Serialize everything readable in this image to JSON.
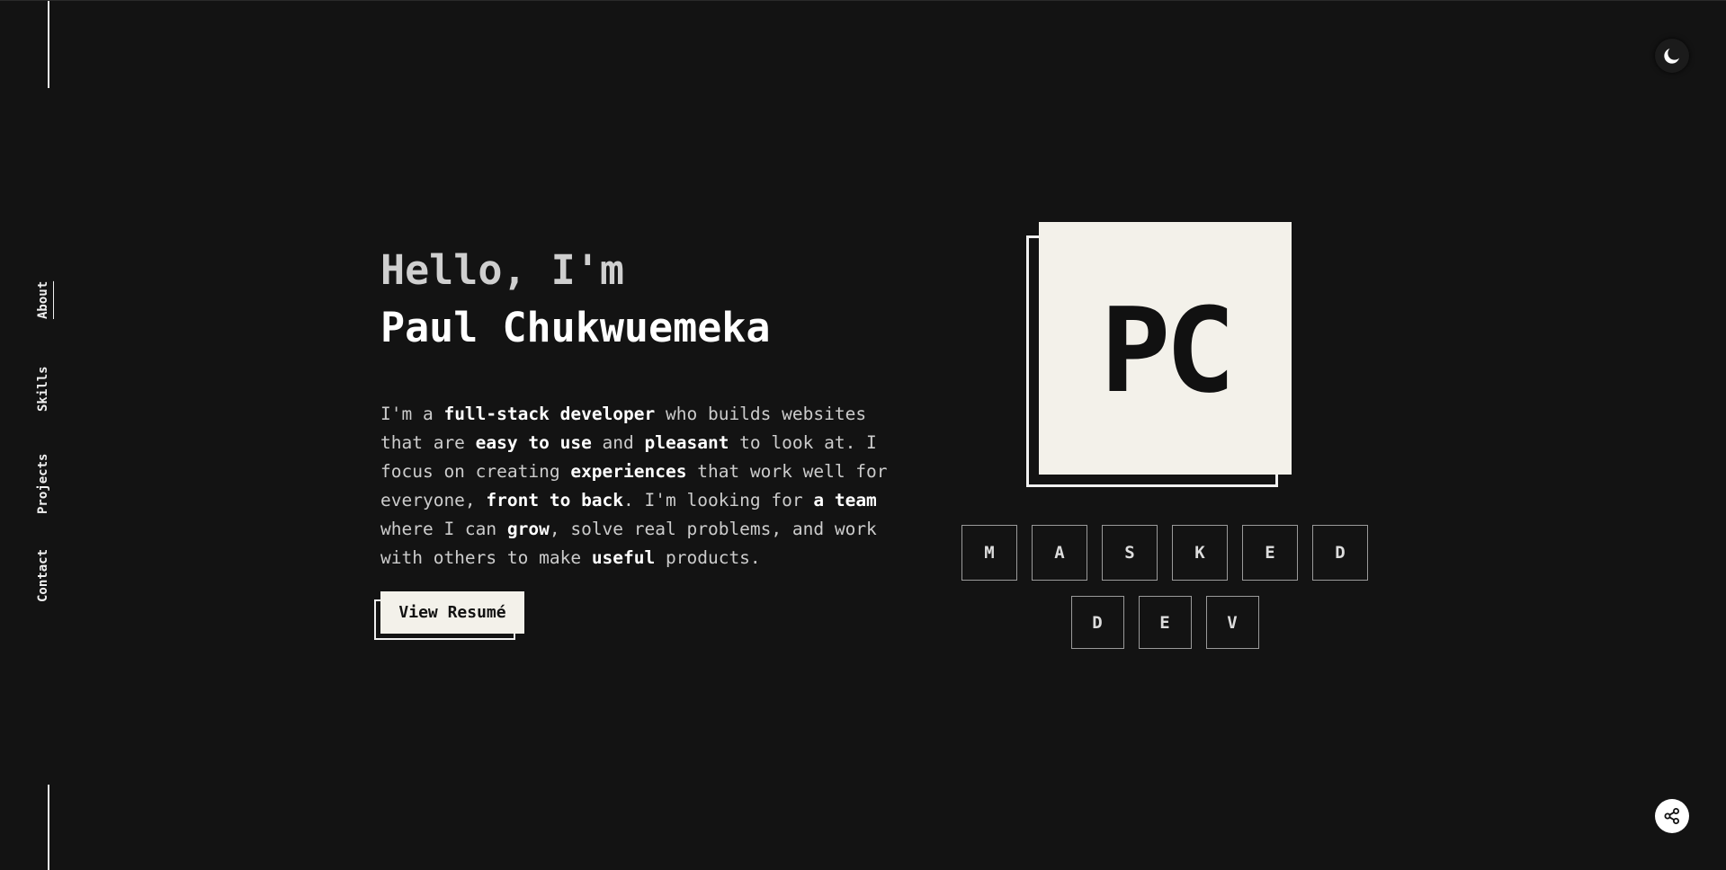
{
  "nav": {
    "items": [
      {
        "label": "About",
        "active": true
      },
      {
        "label": "Skills",
        "active": false
      },
      {
        "label": "Projects",
        "active": false
      },
      {
        "label": "Contact",
        "active": false
      }
    ]
  },
  "controls": {
    "theme_icon": "moon-icon",
    "share_icon": "share-icon"
  },
  "hero": {
    "greeting": "Hello, I'm",
    "name": "Paul Chukwuemeka",
    "bio": [
      {
        "text": "I'm a ",
        "bold": false
      },
      {
        "text": "full-stack developer",
        "bold": true
      },
      {
        "text": " who builds websites that are ",
        "bold": false
      },
      {
        "text": "easy to use",
        "bold": true
      },
      {
        "text": " and ",
        "bold": false
      },
      {
        "text": "pleasant",
        "bold": true
      },
      {
        "text": " to look at. I focus on creating ",
        "bold": false
      },
      {
        "text": "experiences",
        "bold": true
      },
      {
        "text": " that work well for everyone, ",
        "bold": false
      },
      {
        "text": "front to back",
        "bold": true
      },
      {
        "text": ". I'm looking for ",
        "bold": false
      },
      {
        "text": "a team",
        "bold": true
      },
      {
        "text": " where I can ",
        "bold": false
      },
      {
        "text": "grow",
        "bold": true
      },
      {
        "text": ", solve real problems, and work with others to make ",
        "bold": false
      },
      {
        "text": "useful",
        "bold": true
      },
      {
        "text": " products.",
        "bold": false
      }
    ],
    "resume_label": "View Resumé"
  },
  "logo": {
    "initials": "PC"
  },
  "tiles": {
    "row1": [
      "M",
      "A",
      "S",
      "K",
      "E",
      "D"
    ],
    "row2": [
      "D",
      "E",
      "V"
    ]
  },
  "colors": {
    "background": "#131313",
    "accent": "#f3f1ea"
  }
}
